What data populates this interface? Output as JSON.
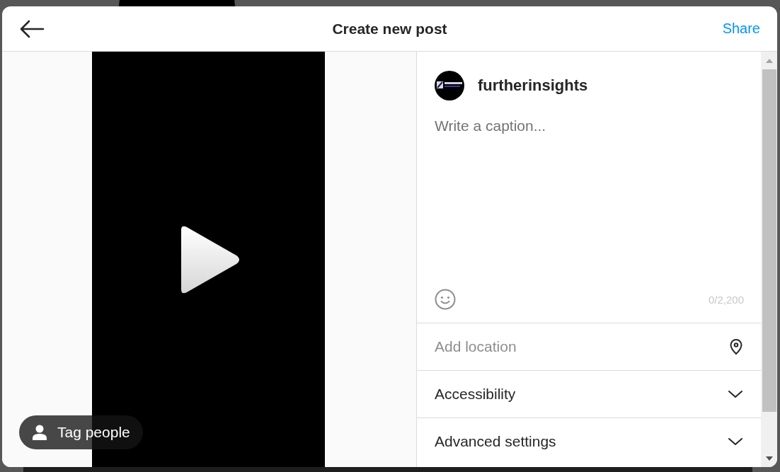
{
  "modal": {
    "title": "Create new post",
    "share": "Share"
  },
  "media": {
    "kind": "video",
    "tag_button": "Tag people"
  },
  "composer": {
    "username": "furtherinsights",
    "caption_placeholder": "Write a caption...",
    "char_count": "0/2,200"
  },
  "options": [
    {
      "kind": "field",
      "placeholder": "Add location"
    },
    {
      "kind": "expander",
      "label": "Accessibility",
      "expanded": false
    },
    {
      "kind": "expander",
      "label": "Advanced settings",
      "expanded": false
    }
  ]
}
